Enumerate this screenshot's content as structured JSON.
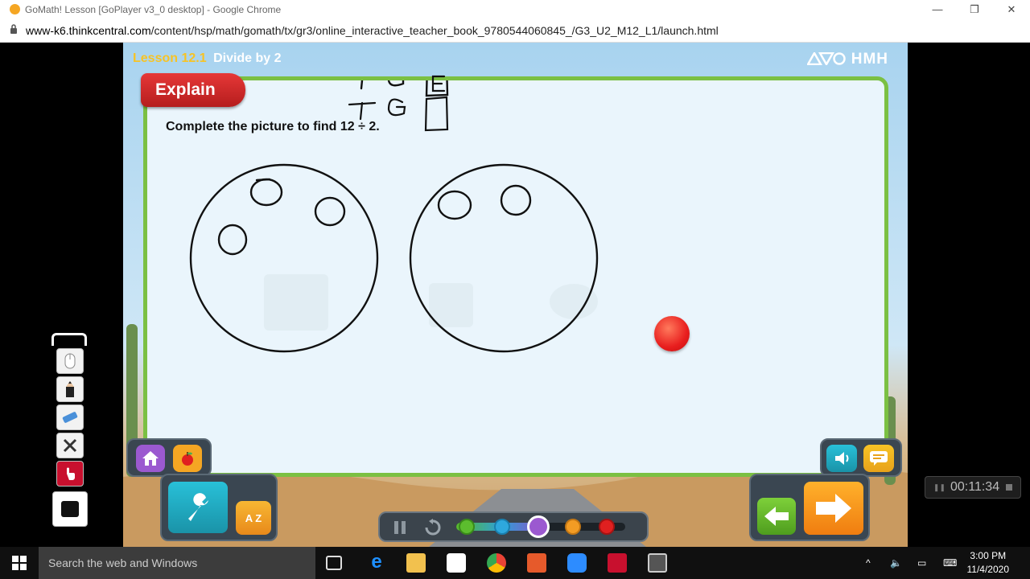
{
  "browser": {
    "tab_title": "GoMath! Lesson [GoPlayer v3_0 desktop] - Google Chrome",
    "url_host": "www-k6.thinkcentral.com",
    "url_path": "/content/hsp/math/gomath/tx/gr3/online_interactive_teacher_book_9780544060845_/G3_U2_M12_L1/launch.html",
    "minimize": "—",
    "restore": "❐",
    "close": "✕"
  },
  "lesson": {
    "number": "Lesson 12.1",
    "name": "Divide by 2",
    "brand": "HMH",
    "section": "Explain",
    "prompt": "Complete the picture to find 12 ÷ 2."
  },
  "annotations": {
    "letters": [
      "T",
      "G",
      "E"
    ]
  },
  "controls": {
    "glossary_label": "A Z",
    "timeline_steps": 5,
    "current_step": 3
  },
  "timer": {
    "value": "00:11:34"
  },
  "taskbar": {
    "search_placeholder": "Search the web and Windows",
    "time": "3:00 PM",
    "date": "11/4/2020"
  },
  "colors": {
    "board_border": "#7bc043",
    "explain_banner": "#d32727",
    "lesson_number": "#f7c325",
    "counter": "#e81e1e"
  }
}
